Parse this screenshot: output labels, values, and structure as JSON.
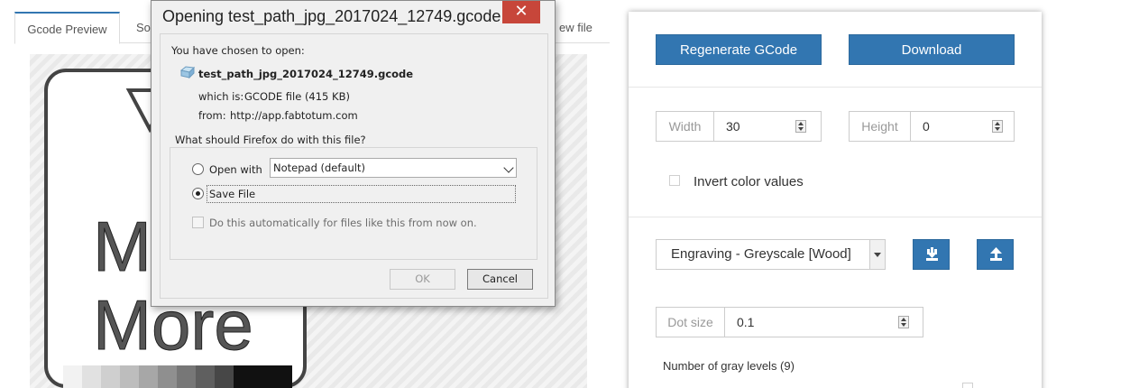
{
  "tabs": [
    "Gcode Preview",
    "So",
    "ew file"
  ],
  "preview": {
    "art_text_line1": "M",
    "art_text_line2": "More"
  },
  "panel": {
    "regenerate_label": "Regenerate GCode",
    "download_label": "Download",
    "width_label": "Width",
    "width_value": "30",
    "height_label": "Height",
    "height_value": "0",
    "invert_label": "Invert color values",
    "invert_checked": false,
    "preset_value": "Engraving - Greyscale [Wood]",
    "dot_size_label": "Dot size",
    "dot_size_value": "0.1",
    "gray_levels_label": "Number of gray levels (9)",
    "icons": [
      "download-icon",
      "upload-icon"
    ],
    "accent_color": "#3276b1"
  },
  "dialog": {
    "title": "Opening test_path_jpg_2017024_12749.gcode",
    "close_glyph": "✕",
    "chosen_text": "You have chosen to open:",
    "filename": "test_path_jpg_2017024_12749.gcode",
    "which_is_label": "which is:",
    "which_is_value": "GCODE file (415 KB)",
    "from_label": "from:",
    "from_value": "http://app.fabtotum.com",
    "question": "What should Firefox do with this file?",
    "open_with_label": "Open with",
    "open_with_value": "Notepad (default)",
    "save_file_label": "Save File",
    "selected_option": "Save File",
    "auto_label": "Do this automatically for files like this from now on.",
    "ok_label": "OK",
    "cancel_label": "Cancel",
    "close_color": "#c7463a"
  }
}
